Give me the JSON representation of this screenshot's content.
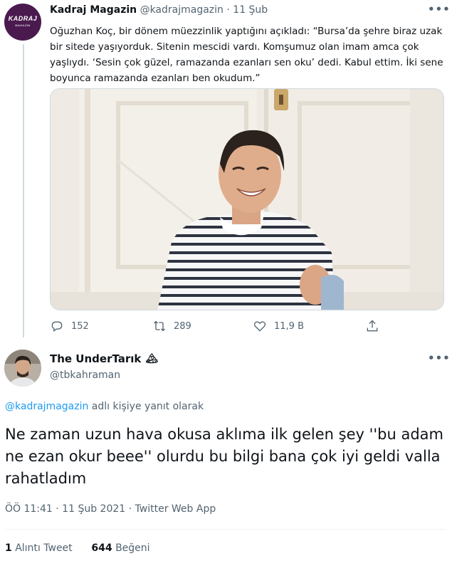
{
  "parent_tweet": {
    "author_name": "Kadraj Magazin",
    "handle": "@kadrajmagazin",
    "separator": "·",
    "date": "11 Şub",
    "avatar_logo_text": "KADRAJ",
    "avatar_logo_subtext": "MAGAZIN",
    "text": "Oğuzhan Koç, bir dönem müezzinlik yaptığını açıkladı: “Bursa’da şehre biraz uzak bir sitede yaşıyorduk. Sitenin mescidi vardı. Komşumuz olan imam amca çok yaşlıydı. ‘Sesin çok güzel, ramazanda ezanları sen oku’ dedi. Kabul ettim. İki sene boyunca ramazanda ezanları ben okudum.”",
    "actions": {
      "replies": "152",
      "retweets": "289",
      "likes": "11,9 B"
    }
  },
  "reply_tweet": {
    "author_name": "The UnderTarık",
    "name_emoji": "🏔",
    "handle": "@tbkahraman",
    "replying_to_mention": "@kadrajmagazin",
    "replying_to_suffix": " adlı kişiye yanıt olarak",
    "text": "Ne zaman uzun hava okusa aklıma ilk gelen şey ''bu adam ne ezan okur beee'' olurdu bu bilgi bana çok iyi geldi valla rahatladım",
    "meta": "ÖÖ 11:41 · 11 Şub 2021 · Twitter Web App",
    "retweet_count": "1",
    "retweet_label": "Alıntı Tweet",
    "like_count": "644",
    "like_label": "Beğeni"
  },
  "icons": {
    "more": "more-horizontal-icon",
    "reply": "reply-icon",
    "retweet": "retweet-icon",
    "like": "heart-icon",
    "share": "share-icon"
  },
  "colors": {
    "text_primary": "#0f1419",
    "text_secondary": "#536471",
    "link": "#1d9bf0",
    "border": "#cfd9de",
    "avatar_brand": "#4a1a4e"
  }
}
